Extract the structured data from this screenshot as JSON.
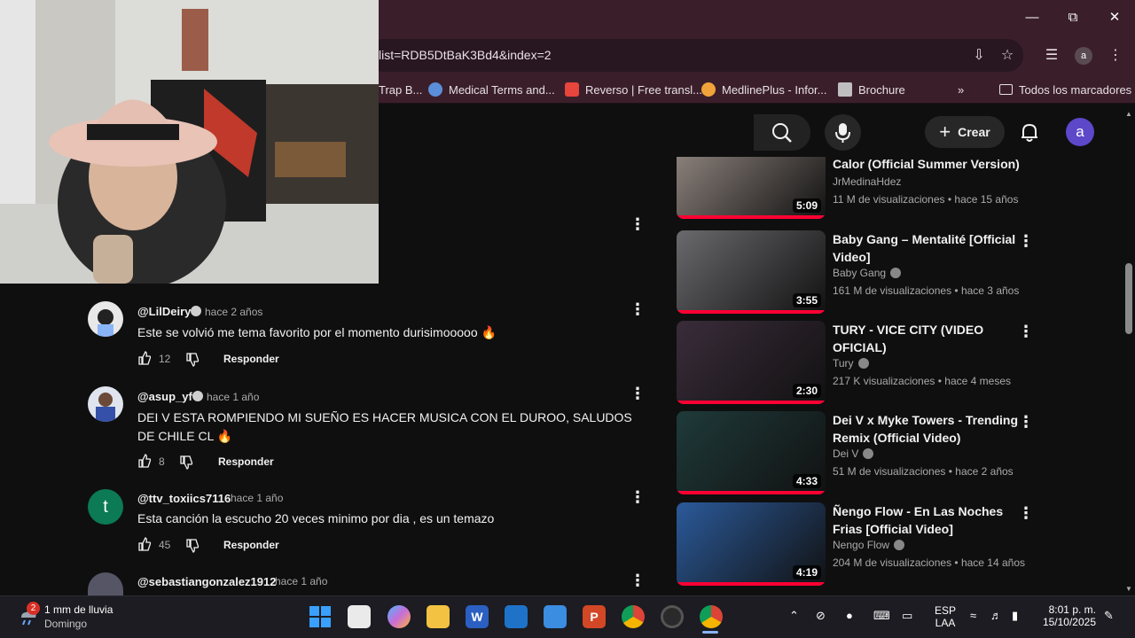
{
  "browser": {
    "url": "list=RDB5DtBaK3Bd4&index=2",
    "bookmarks": [
      {
        "label": "Trap B...",
        "color": "#ffffff"
      },
      {
        "label": "Medical Terms and...",
        "color": "#5b8fd9"
      },
      {
        "label": "Reverso | Free transl...",
        "color": "#e8453c"
      },
      {
        "label": "MedlinePlus - Infor...",
        "color": "#f2a23a"
      },
      {
        "label": "Brochure",
        "color": "#bfbfbf"
      }
    ],
    "all_bookmarks_label": "Todos los marcadores",
    "profile_initial": "a"
  },
  "youtube": {
    "create_label": "Crear",
    "avatar_initial": "a"
  },
  "comments": [
    {
      "handle": "@LilDeiry",
      "verified": true,
      "time": "hace 2 años",
      "text": "Este se volvió me tema favorito por el momento durisimooooo 🔥",
      "likes": "12",
      "reply": "Responder",
      "avatar_color": "#e8e8e8"
    },
    {
      "handle": "@asup_yf",
      "verified": true,
      "time": "hace 1 año",
      "text": "DEI V ESTA ROMPIENDO MI SUEÑO ES HACER MUSICA CON EL DUROO, SALUDOS DE CHILE CL 🔥",
      "likes": "8",
      "reply": "Responder",
      "avatar_color": "#3550a8"
    },
    {
      "handle": "@ttv_toxiics7116",
      "verified": false,
      "time": "hace 1 año",
      "text": "Esta canción la escucho 20 veces minimo por dia , es un temazo",
      "likes": "45",
      "reply": "Responder",
      "avatar_color": "#0b7a55",
      "avatar_initial": "t"
    },
    {
      "handle": "@sebastiangonzalez1912",
      "verified": false,
      "time": "hace 1 año",
      "text": "",
      "likes": "",
      "reply": "",
      "avatar_color": "#556"
    }
  ],
  "videos": [
    {
      "title": "Calor (Official Summer Version)",
      "channel": "JrMedinaHdez",
      "verified": false,
      "views": "11 M de visualizaciones",
      "age": "hace 15 años",
      "duration": "5:09",
      "thumb_color": "#8a7f7a",
      "watched": 1.0
    },
    {
      "title": "Baby Gang – Mentalité [Official Video]",
      "channel": "Baby Gang",
      "verified": true,
      "views": "161 M de visualizaciones",
      "age": "hace 3 años",
      "duration": "3:55",
      "thumb_color": "#6a6a6e",
      "watched": 1.0
    },
    {
      "title": "TURY - VICE CITY (VIDEO OFICIAL)",
      "channel": "Tury",
      "verified": true,
      "views": "217 K visualizaciones",
      "age": "hace 4 meses",
      "duration": "2:30",
      "thumb_color": "#3a2c3a",
      "watched": 1.0
    },
    {
      "title": "Dei V x Myke Towers - Trending Remix (Official Video)",
      "channel": "Dei V",
      "verified": true,
      "views": "51 M de visualizaciones",
      "age": "hace 2 años",
      "duration": "4:33",
      "thumb_color": "#1f3a3a",
      "watched": 1.0
    },
    {
      "title": "Ñengo Flow - En Las Noches Frias [Official Video]",
      "channel": "Nengo Flow",
      "verified": true,
      "views": "204 M de visualizaciones",
      "age": "hace 14 años",
      "duration": "4:19",
      "thumb_color": "#2b5a9a",
      "watched": 1.0
    }
  ],
  "taskbar": {
    "weather_badge": "2",
    "weather_title": "1 mm de lluvia",
    "weather_sub": "Domingo",
    "lang_top": "ESP",
    "lang_bottom": "LAA",
    "time": "8:01 p. m.",
    "date": "15/10/2025"
  }
}
